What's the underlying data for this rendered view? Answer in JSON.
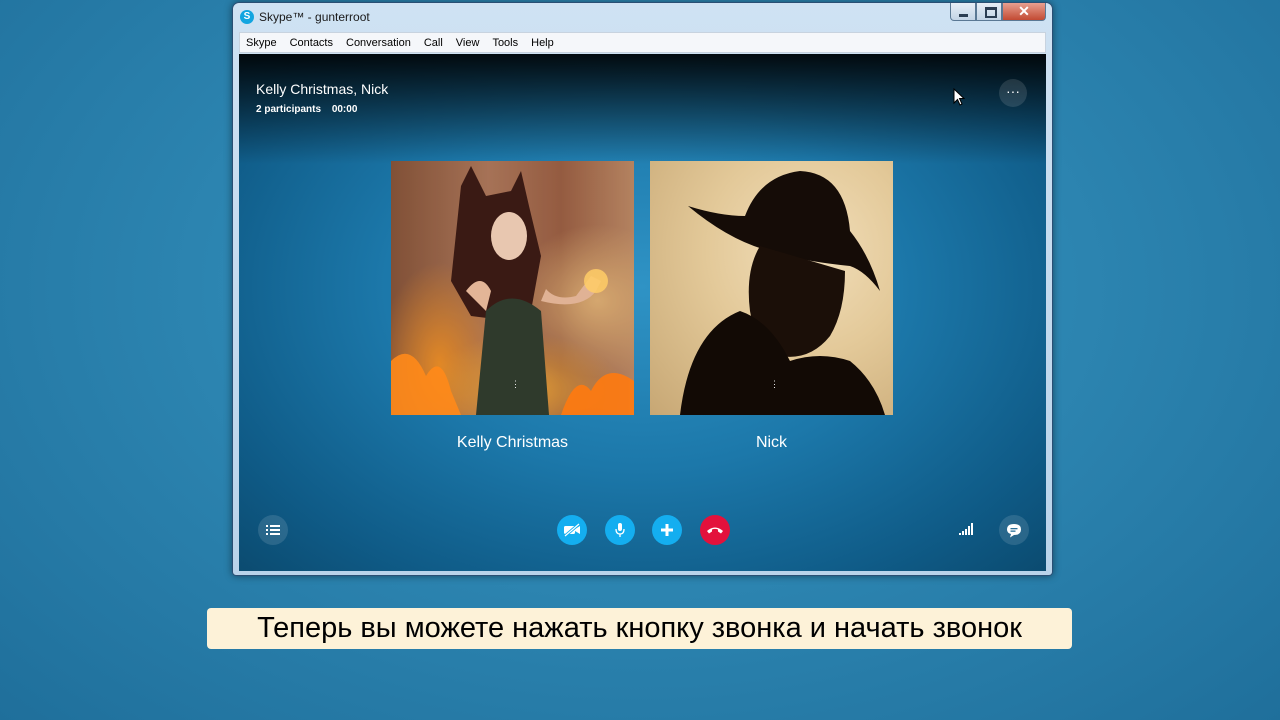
{
  "window": {
    "title": "Skype™ - gunterroot",
    "app_icon_letter": "S",
    "close_glyph": "✕"
  },
  "menu": [
    "Skype",
    "Contacts",
    "Conversation",
    "Call",
    "View",
    "Tools",
    "Help"
  ],
  "conversation": {
    "title": "Kelly Christmas, Nick",
    "participants_count": "2 participants",
    "duration": "00:00",
    "more_label": "···"
  },
  "participants": [
    {
      "name": "Kelly Christmas"
    },
    {
      "name": "Nick"
    }
  ],
  "controls": {
    "video_state": "off",
    "accent_color": "#14aef0",
    "end_call_color": "#e3113c"
  },
  "caption": "Теперь вы можете нажать кнопку звонка и начать звонок"
}
